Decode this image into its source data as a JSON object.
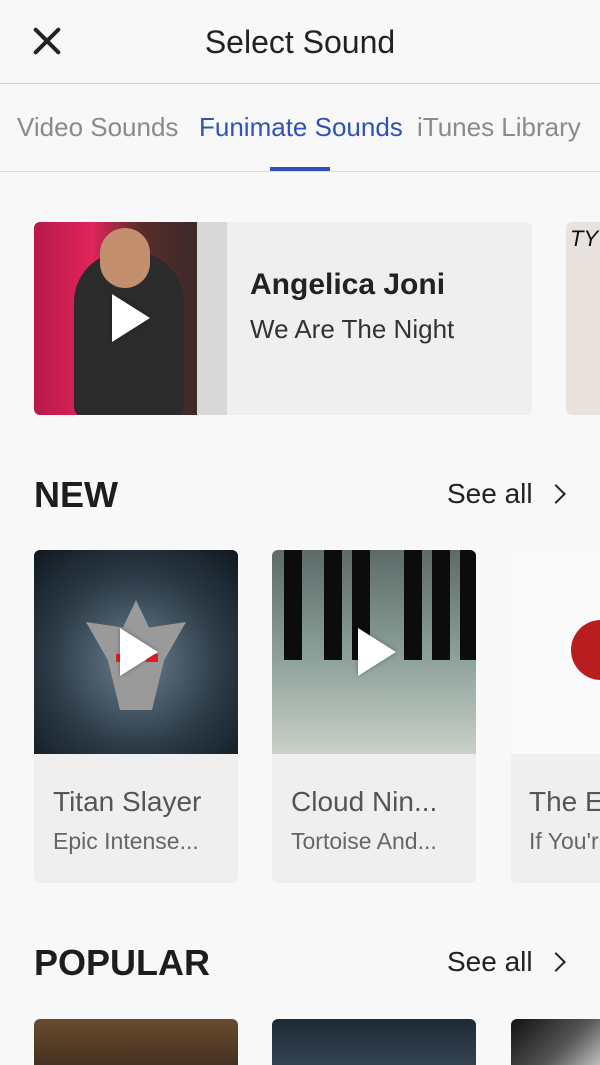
{
  "header": {
    "title": "Select Sound"
  },
  "tabs": [
    {
      "label": "Video Sounds"
    },
    {
      "label": "Funimate Sounds"
    },
    {
      "label": "iTunes Library"
    }
  ],
  "featured": {
    "artist": "Angelica Joni",
    "song": "We Are The Night",
    "peek_text": "TY"
  },
  "sections": {
    "new": {
      "title": "NEW",
      "see_all": "See all",
      "cards": [
        {
          "title": "Titan Slayer",
          "subtitle": "Epic Intense..."
        },
        {
          "title": "Cloud Nin...",
          "subtitle": "Tortoise And..."
        },
        {
          "title": "The E",
          "subtitle": "If You'r"
        }
      ]
    },
    "popular": {
      "title": "POPULAR",
      "see_all": "See all"
    }
  },
  "colors": {
    "accent": "#3052b8",
    "background": "#f8f8f8",
    "card": "#efefef"
  }
}
